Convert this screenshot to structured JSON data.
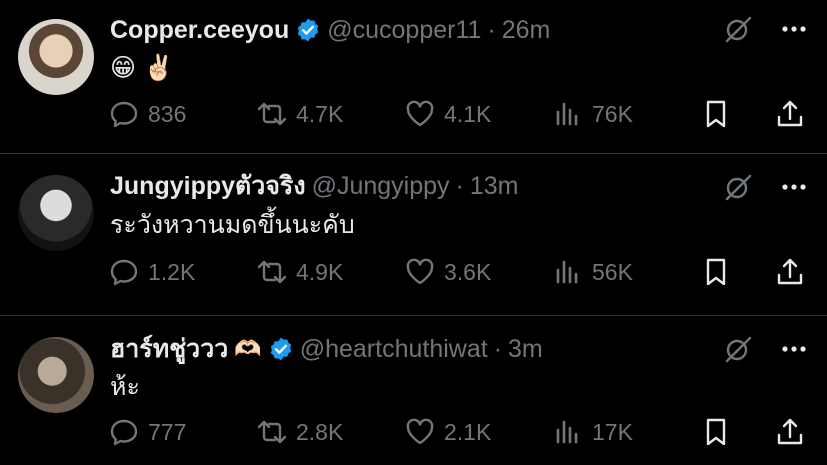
{
  "tweets": [
    {
      "name": "Copper.ceeyou",
      "verified": true,
      "handle": "@cucopper11",
      "time": "26m",
      "text": "😁 ✌🏻",
      "replies": "836",
      "retweets": "4.7K",
      "likes": "4.1K",
      "views": "76K"
    },
    {
      "name": "Jungyippyตัวจริง",
      "verified": false,
      "handle": "@Jungyippy",
      "time": "13m",
      "text": "ระวังหวานมดขึ้นนะคับ",
      "replies": "1.2K",
      "retweets": "4.9K",
      "likes": "3.6K",
      "views": "56K"
    },
    {
      "name": "ฮาร์ทชู่ววว",
      "name_emoji": "🫶🏻",
      "verified": true,
      "handle": "@heartchuthiwat",
      "time": "3m",
      "text": "ห้ะ",
      "replies": "777",
      "retweets": "2.8K",
      "likes": "2.1K",
      "views": "17K"
    }
  ],
  "separator": "·",
  "colors": {
    "background": "#000000",
    "text": "#e7e9ea",
    "muted": "#71767b",
    "verified": "#1d9bf0",
    "divider": "#2f3336"
  },
  "icons": [
    "grok-icon",
    "more-icon",
    "reply-icon",
    "retweet-icon",
    "like-icon",
    "views-icon",
    "bookmark-icon",
    "share-icon"
  ]
}
